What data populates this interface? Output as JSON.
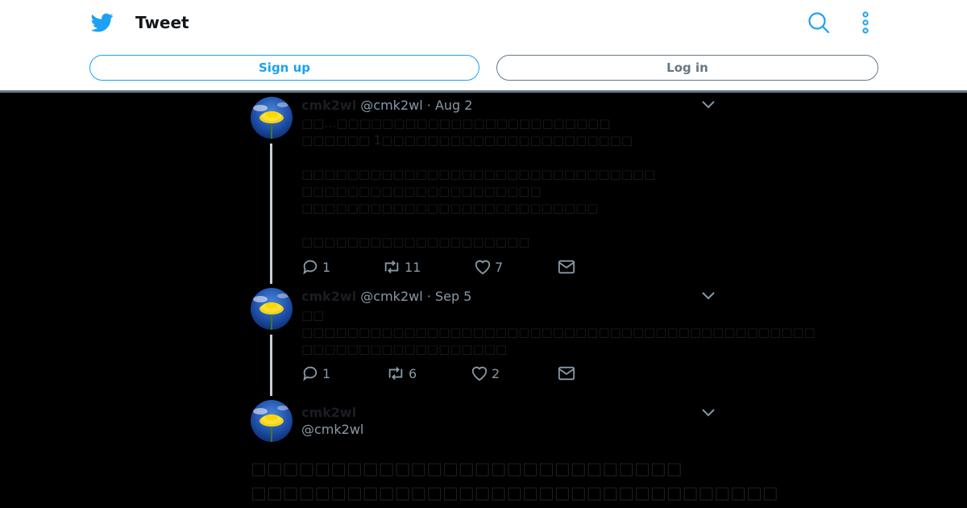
{
  "header": {
    "title": "Tweet",
    "signup_label": "Sign up",
    "login_label": "Log in"
  },
  "colors": {
    "brand": "#1da1f2",
    "muted": "#8899a6",
    "background": "#000000"
  },
  "thread": [
    {
      "display_name": "cmk2wl",
      "handle": "@cmk2wl",
      "separator": "·",
      "date": "Aug 2",
      "text": "□□…□□□□□□□□□□□□□□□□□□□□□□□□\n□□□□□□ 1□□□□□□□□□□□□□□□□□□□□□□\n\n□□□□□□□□□□□□□□□□□□□□□□□□□□□□□□□\n□□□□□□□□□□□□□□□□□□□□□\n□□□□□□□□□□□□□□□□□□□□□□□□□□\n\n□□□□□□□□□□□□□□□□□□□□",
      "replies": "1",
      "retweets": "11",
      "likes": "7"
    },
    {
      "display_name": "cmk2wl",
      "handle": "@cmk2wl",
      "separator": "·",
      "date": "Sep 5",
      "text": "□□\n□□□□□□□□□□□□□□□□□□□□□□□□□□□□□□□□□□□□□□□□□□□□□\n□□□□□□□□□□□□□□□□□□",
      "replies": "1",
      "retweets": "6",
      "likes": "2"
    }
  ],
  "main_tweet": {
    "display_name": "cmk2wl",
    "handle": "@cmk2wl",
    "text": "□□□□□□□□□□□□□□□□□□□□□□□□□□□\n□□□□□□□□□□□□□□□□□□□□□□□□□□□□□□□□□"
  },
  "icons": {
    "brand": "twitter-bird-icon",
    "search": "search-icon",
    "more": "more-vertical-icon",
    "chevron": "chevron-down-icon",
    "reply": "reply-icon",
    "retweet": "retweet-icon",
    "like": "heart-icon",
    "message": "mail-icon"
  }
}
